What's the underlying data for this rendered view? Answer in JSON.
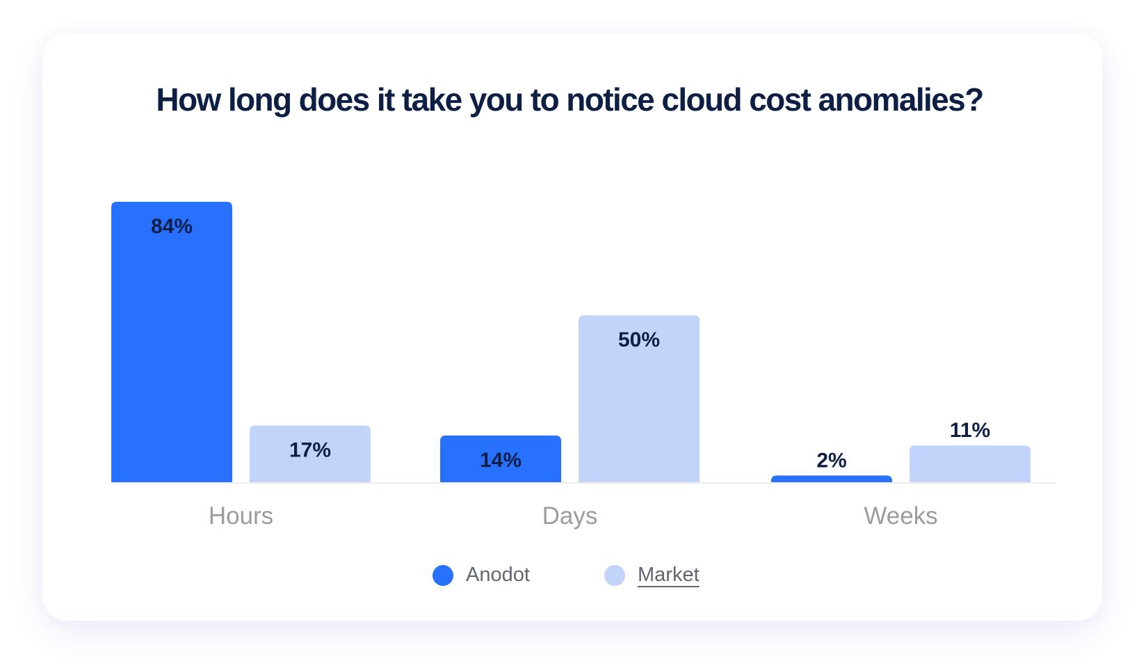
{
  "chart_data": {
    "type": "bar",
    "title": "How long does it take you to notice cloud cost anomalies?",
    "categories": [
      "Hours",
      "Days",
      "Weeks"
    ],
    "series": [
      {
        "name": "Anodot",
        "color": "#2871ff",
        "values": [
          84,
          14,
          2
        ],
        "labels": [
          "84%",
          "14%",
          "2%"
        ]
      },
      {
        "name": "Market",
        "color": "#c2d4fa",
        "values": [
          17,
          50,
          11
        ],
        "labels": [
          "17%",
          "50%",
          "11%"
        ]
      }
    ],
    "xlabel": "",
    "ylabel": "",
    "ylim": [
      0,
      84
    ],
    "grid": false,
    "legend_position": "bottom-center",
    "value_unit": "%"
  },
  "legend": {
    "items": [
      {
        "label": "Anodot",
        "color": "#2871ff"
      },
      {
        "label": "Market",
        "color": "#c2d4fa"
      }
    ]
  }
}
